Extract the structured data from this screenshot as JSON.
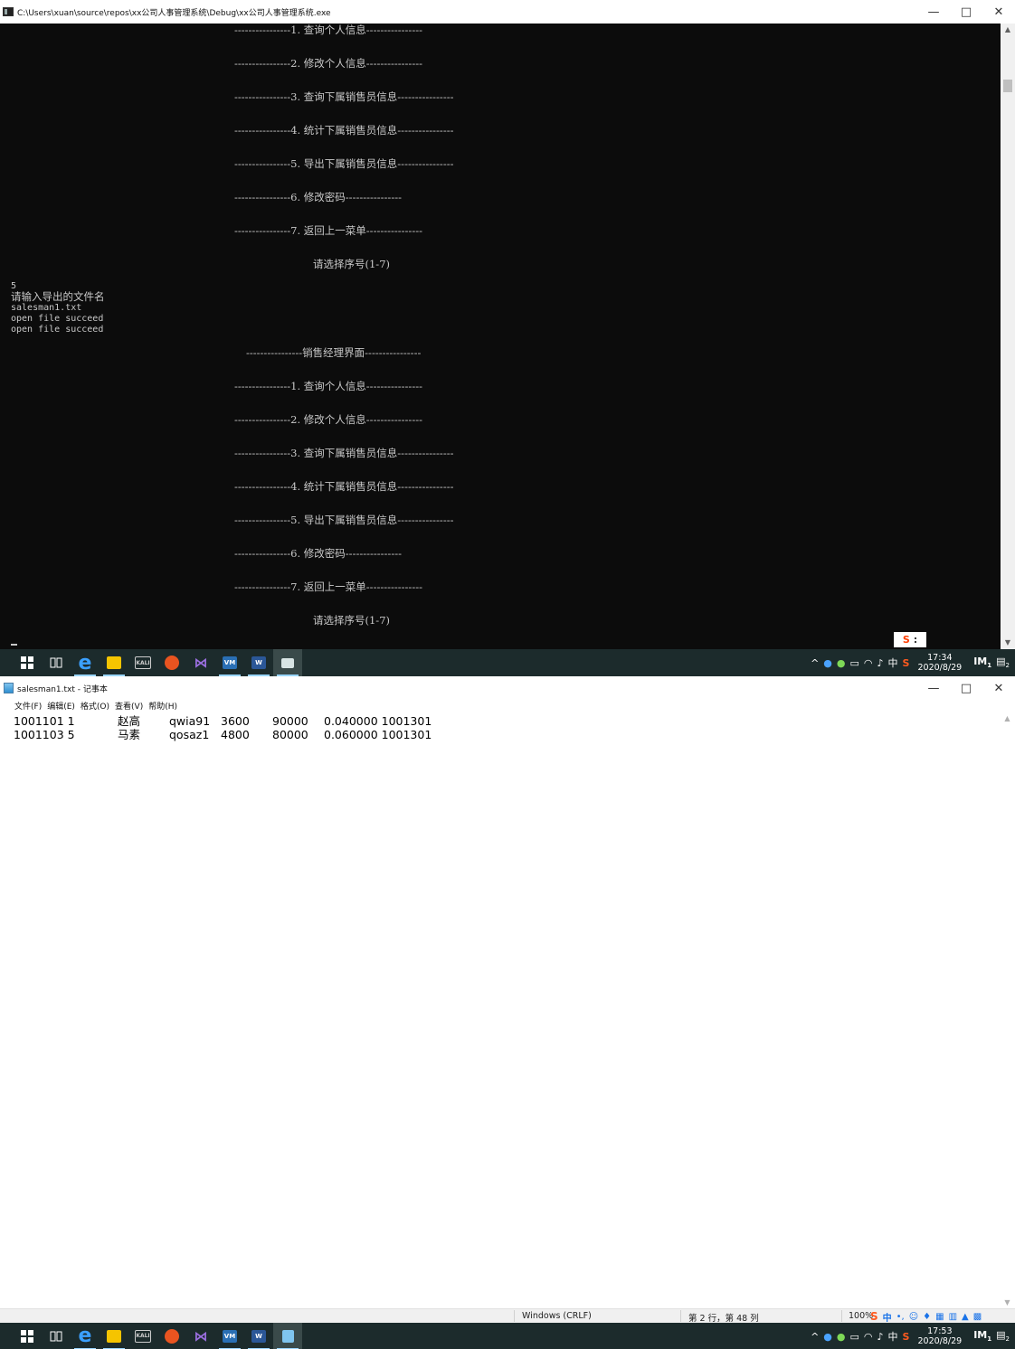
{
  "console": {
    "title": "C:\\Users\\xuan\\source\\repos\\xx公司人事管理系统\\Debug\\xx公司人事管理系统.exe",
    "menu1": [
      "----------------1. 查询个人信息----------------",
      "----------------2. 修改个人信息----------------",
      "----------------3. 查询下属销售员信息----------------",
      "----------------4. 统计下属销售员信息----------------",
      "----------------5. 导出下属销售员信息----------------",
      "----------------6. 修改密码----------------",
      "----------------7. 返回上一菜单----------------"
    ],
    "prompt1": "请选择序号(1-7)",
    "input_choice": "5",
    "ask_filename": "请输入导出的文件名",
    "filename": "salesman1.txt",
    "log1": "open file succeed",
    "log2": "open file succeed",
    "menu_header": "----------------销售经理界面----------------",
    "menu2": [
      "----------------1. 查询个人信息----------------",
      "----------------2. 修改个人信息----------------",
      "----------------3. 查询下属销售员信息----------------",
      "----------------4. 统计下属销售员信息----------------",
      "----------------5. 导出下属销售员信息----------------",
      "----------------6. 修改密码----------------",
      "----------------7. 返回上一菜单----------------"
    ],
    "prompt2": "请选择序号(1-7)"
  },
  "ime_float": {
    "logo": "S",
    "menu": ":"
  },
  "window_controls": {
    "minimize": "—",
    "maximize": "□",
    "close": "✕"
  },
  "taskbar_top": {
    "clock_time": "17:34",
    "clock_date": "2020/8/29",
    "tray_input": "中",
    "notif_count": "2",
    "im_badge": "1"
  },
  "taskbar_icons": [
    {
      "name": "start",
      "glyph": "⊞"
    },
    {
      "name": "task-view",
      "glyph": "⧉"
    },
    {
      "name": "edge",
      "glyph": "e"
    },
    {
      "name": "file-explorer",
      "glyph": "▬"
    },
    {
      "name": "kali",
      "glyph": "KALI"
    },
    {
      "name": "ubuntu",
      "glyph": "◉"
    },
    {
      "name": "visual-studio",
      "glyph": "⋈"
    },
    {
      "name": "vmware",
      "glyph": "VM"
    },
    {
      "name": "word",
      "glyph": "W"
    }
  ],
  "notepad": {
    "title": "salesman1.txt - 记事本",
    "menus": [
      "文件(F)",
      "编辑(E)",
      "格式(O)",
      "查看(V)",
      "帮助(H)"
    ],
    "rows": [
      [
        "1001101 1",
        "赵高",
        "qwia91",
        "3600",
        "90000",
        "0.040000 1001301"
      ],
      [
        "1001103 5",
        "马素",
        "qosaz1",
        "4800",
        "80000",
        "0.060000 1001301"
      ]
    ],
    "status": {
      "line_ending": "Windows (CRLF)",
      "position": "第 2 行，第 48 列",
      "zoom": "100%"
    }
  },
  "taskbar_bottom": {
    "clock_time": "17:53",
    "clock_date": "2020/8/29",
    "tray_input": "中",
    "notif_count": "2",
    "im_badge": "1"
  },
  "colors": {
    "console_bg": "#0c0c0c",
    "console_text": "#c8c8c8",
    "taskbar_bg": "#1c2b2c",
    "sogou_orange": "#ff5a1f"
  }
}
